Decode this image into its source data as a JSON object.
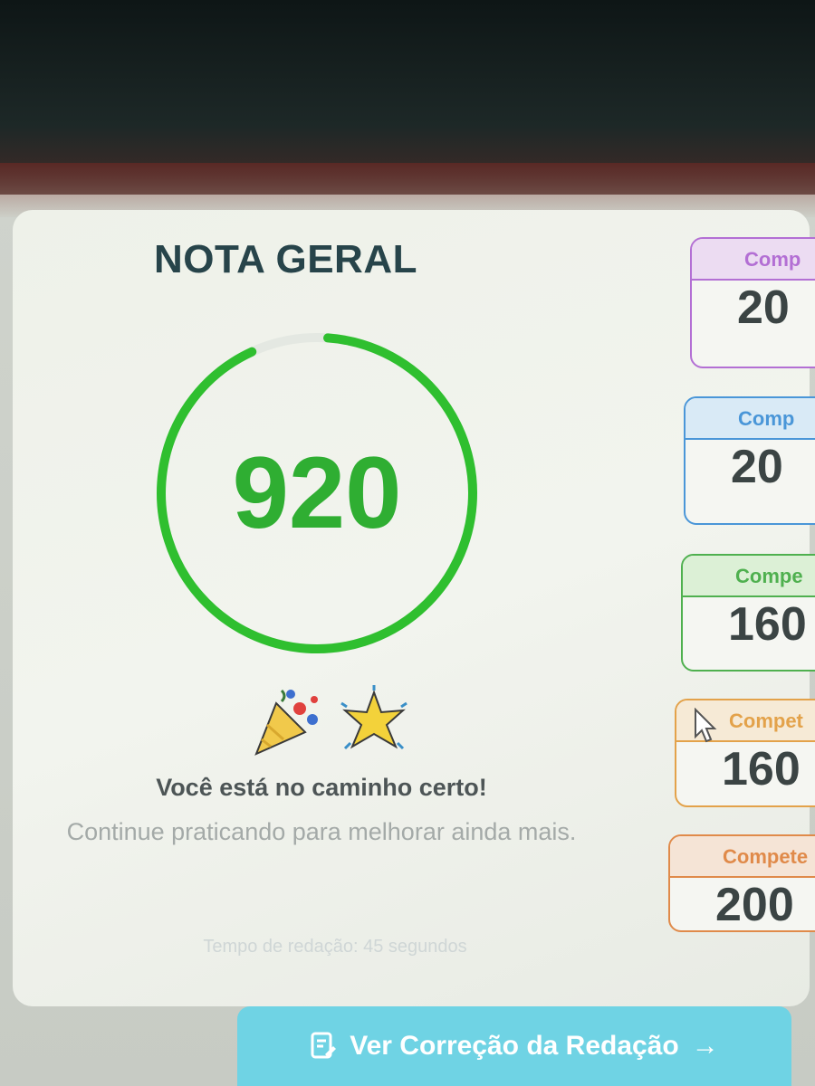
{
  "result": {
    "title": "NOTA GERAL",
    "score": "920",
    "score_fraction": 0.92,
    "ring_color": "#2fbf2f",
    "emojis": [
      "party-popper-icon",
      "sparkle-star-icon"
    ],
    "message_main": "Você está no caminho certo!",
    "message_sub": "Continue praticando para melhorar ainda mais.",
    "time_text": "Tempo de redação: 45 segundos"
  },
  "competencies": [
    {
      "label": "Comp",
      "value": "20",
      "accent": "#b36fd4",
      "head_bg": "#ecdcf2"
    },
    {
      "label": "Comp",
      "value": "20",
      "accent": "#4a96d8",
      "head_bg": "#d9eaf6"
    },
    {
      "label": "Compe",
      "value": "160",
      "accent": "#4fb04f",
      "head_bg": "#dcf0d6"
    },
    {
      "label": "Compet",
      "value": "160",
      "accent": "#e3a24a",
      "head_bg": "#f6ead6"
    },
    {
      "label": "Compete",
      "value": "200",
      "accent": "#e08a4a",
      "head_bg": "#f5e4d6"
    }
  ],
  "actions": {
    "view_correction_label": "Ver Correção da Redação",
    "view_correction_arrow": "→"
  }
}
